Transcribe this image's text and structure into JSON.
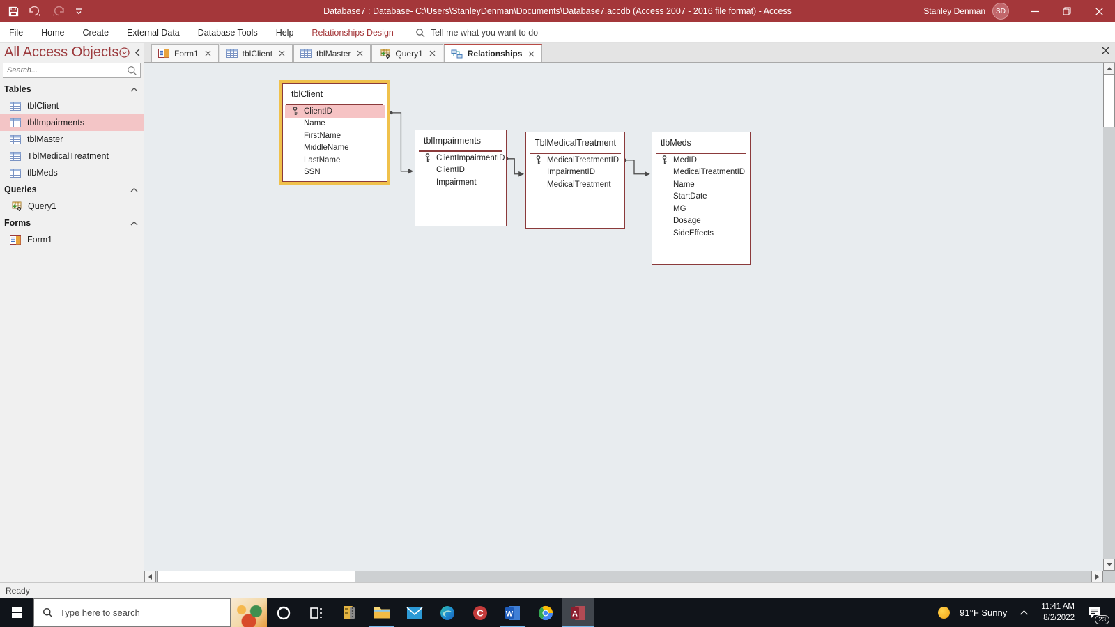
{
  "titlebar": {
    "title": "Database7 : Database- C:\\Users\\StanleyDenman\\Documents\\Database7.accdb (Access 2007 - 2016 file format)  -  Access",
    "user_name": "Stanley Denman",
    "user_initials": "SD"
  },
  "ribbon": {
    "tabs": [
      "File",
      "Home",
      "Create",
      "External Data",
      "Database Tools",
      "Help"
    ],
    "contextual_tab": "Relationships Design",
    "tell_me": "Tell me what you want to do"
  },
  "nav_pane": {
    "title": "All Access Objects",
    "search_placeholder": "Search...",
    "groups": [
      {
        "label": "Tables",
        "icon": "table-icon",
        "items": [
          {
            "label": "tblClient",
            "selected": false
          },
          {
            "label": "tblImpairments",
            "selected": true
          },
          {
            "label": "tblMaster",
            "selected": false
          },
          {
            "label": "TblMedicalTreatment",
            "selected": false
          },
          {
            "label": "tlbMeds",
            "selected": false
          }
        ]
      },
      {
        "label": "Queries",
        "icon": "query-icon",
        "items": [
          {
            "label": "Query1",
            "selected": false
          }
        ]
      },
      {
        "label": "Forms",
        "icon": "form-icon",
        "items": [
          {
            "label": "Form1",
            "selected": false
          }
        ]
      }
    ]
  },
  "doc_tabs": [
    {
      "label": "Form1",
      "icon": "form-icon",
      "active": false
    },
    {
      "label": "tblClient",
      "icon": "table-icon",
      "active": false
    },
    {
      "label": "tblMaster",
      "icon": "table-icon",
      "active": false
    },
    {
      "label": "Query1",
      "icon": "query-icon",
      "active": false
    },
    {
      "label": "Relationships",
      "icon": "relationships-icon",
      "active": true
    }
  ],
  "relationships": {
    "tables": [
      {
        "name": "tblClient",
        "pk": "ClientID",
        "pk_highlighted": true,
        "selected": true,
        "fields": [
          "ClientID",
          "Name",
          "FirstName",
          "MiddleName",
          "LastName",
          "SSN"
        ]
      },
      {
        "name": "tblImpairments",
        "pk": "ClientImpairmentID",
        "pk_highlighted": false,
        "selected": false,
        "fields": [
          "ClientImpairmentID",
          "ClientID",
          "Impairment"
        ]
      },
      {
        "name": "TblMedicalTreatment",
        "pk": "MedicalTreatmentID",
        "pk_highlighted": false,
        "selected": false,
        "fields": [
          "MedicalTreatmentID",
          "ImpairmentID",
          "MedicalTreatment"
        ]
      },
      {
        "name": "tlbMeds",
        "pk": "MedID",
        "pk_highlighted": false,
        "selected": false,
        "fields": [
          "MedID",
          "MedicalTreatmentID",
          "Name",
          "StartDate",
          "MG",
          "Dosage",
          "SideEffects"
        ]
      }
    ],
    "links": [
      {
        "from": "tblClient.ClientID",
        "to": "tblImpairments.ClientID"
      },
      {
        "from": "tblImpairments.ClientImpairmentID",
        "to": "TblMedicalTreatment.ImpairmentID"
      },
      {
        "from": "TblMedicalTreatment.MedicalTreatmentID",
        "to": "tlbMeds.MedicalTreatmentID"
      }
    ]
  },
  "status_bar": {
    "text": "Ready"
  },
  "taskbar": {
    "search_placeholder": "Type here to search",
    "icons": [
      "widgets",
      "cortana",
      "task-view",
      "zip",
      "file-explorer",
      "mail",
      "edge",
      "ccleaner",
      "word",
      "chrome",
      "access"
    ],
    "tray": {
      "weather": "91°F  Sunny",
      "time": "11:41 AM",
      "date": "8/2/2022",
      "notification_count": "23"
    }
  },
  "colors": {
    "accent": "#a4373a",
    "selection_pink": "#f3c5c6",
    "selected_table_frame": "#f0c14b",
    "table_border": "#8b3a3b",
    "taskbar_indicator": "#76b9ed"
  }
}
